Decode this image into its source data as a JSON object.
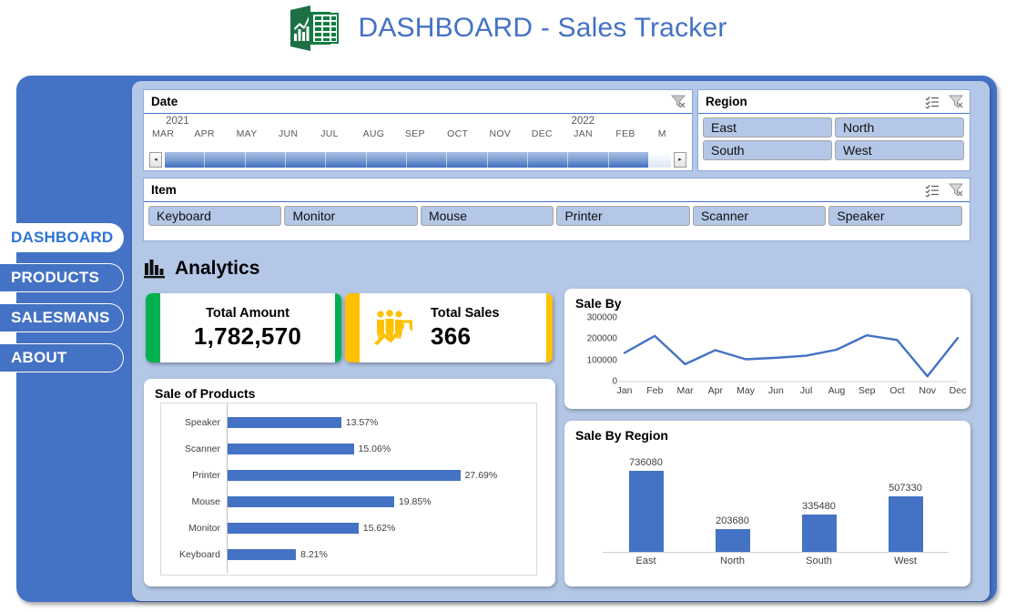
{
  "header": {
    "title": "DASHBOARD - Sales Tracker",
    "icon": "excel-workbook-icon"
  },
  "nav": {
    "items": [
      {
        "label": "DASHBOARD",
        "active": true
      },
      {
        "label": "PRODUCTS",
        "active": false
      },
      {
        "label": "SALESMANS",
        "active": false
      },
      {
        "label": "ABOUT",
        "active": false
      }
    ]
  },
  "slicers": {
    "date": {
      "title": "Date",
      "clear_icon": "clear-filter-icon",
      "years": [
        {
          "label": "2021",
          "left_pct": 1.5
        },
        {
          "label": "2022",
          "left_pct": 80.0
        }
      ],
      "months": [
        "MAR",
        "APR",
        "MAY",
        "JUN",
        "JUL",
        "AUG",
        "SEP",
        "OCT",
        "NOV",
        "DEC",
        "JAN",
        "FEB",
        "M"
      ],
      "prev_label": "◂",
      "next_label": "▸",
      "selected_cells": 12
    },
    "region": {
      "title": "Region",
      "multiselect_icon": "multi-select-icon",
      "clear_icon": "clear-filter-icon",
      "items": [
        "East",
        "North",
        "South",
        "West"
      ]
    },
    "item": {
      "title": "Item",
      "multiselect_icon": "multi-select-icon",
      "clear_icon": "clear-filter-icon",
      "items": [
        "Keyboard",
        "Monitor",
        "Mouse",
        "Printer",
        "Scanner",
        "Speaker"
      ]
    }
  },
  "analytics": {
    "label": "Analytics",
    "icon": "bar-chart-icon"
  },
  "kpis": [
    {
      "label": "Total Amount",
      "value": "1,782,570",
      "accent": "#00B050",
      "icon": null
    },
    {
      "label": "Total Sales",
      "value": "366",
      "accent": "#FFC000",
      "icon": "people-growth-icon"
    }
  ],
  "colors": {
    "frame_blue": "#4472C4",
    "panel_blue": "#B4C7E7",
    "series_blue": "#4472C4",
    "title_blue": "#4472C4",
    "green_accent": "#00B050",
    "amber_accent": "#FFC000"
  },
  "chart_data": [
    {
      "id": "sale_by_month",
      "type": "line",
      "title": "Sale By",
      "xlabel": "",
      "ylabel": "",
      "categories": [
        "Jan",
        "Feb",
        "Mar",
        "Apr",
        "May",
        "Jun",
        "Jul",
        "Aug",
        "Sep",
        "Oct",
        "Nov",
        "Dec"
      ],
      "values": [
        135000,
        215000,
        82000,
        148000,
        105000,
        112000,
        122000,
        150000,
        218000,
        196000,
        25000,
        205000
      ],
      "yticks": [
        0,
        100000,
        200000,
        300000
      ],
      "ylim": [
        0,
        300000
      ],
      "grid": false,
      "legend": false,
      "series_color": "#4472C4"
    },
    {
      "id": "sale_of_products",
      "type": "bar",
      "title": "Sale of Products",
      "orientation": "horizontal",
      "xlabel": "",
      "ylabel": "",
      "categories": [
        "Speaker",
        "Scanner",
        "Printer",
        "Mouse",
        "Monitor",
        "Keyboard"
      ],
      "values": [
        13.57,
        15.06,
        27.69,
        19.85,
        15.62,
        8.21
      ],
      "labels": [
        "13.57%",
        "15.06%",
        "27.69%",
        "19.85%",
        "15.62%",
        "8.21%"
      ],
      "unit": "%",
      "xlim": [
        0,
        30
      ],
      "grid": false,
      "legend": false,
      "series_color": "#4472C4"
    },
    {
      "id": "sale_by_region",
      "type": "bar",
      "title": "Sale By Region",
      "orientation": "vertical",
      "xlabel": "",
      "ylabel": "",
      "categories": [
        "East",
        "North",
        "South",
        "West"
      ],
      "values": [
        736080,
        203680,
        335480,
        507330
      ],
      "labels": [
        "736080",
        "203680",
        "335480",
        "507330"
      ],
      "ylim": [
        0,
        800000
      ],
      "grid": false,
      "legend": false,
      "series_color": "#4472C4"
    }
  ]
}
